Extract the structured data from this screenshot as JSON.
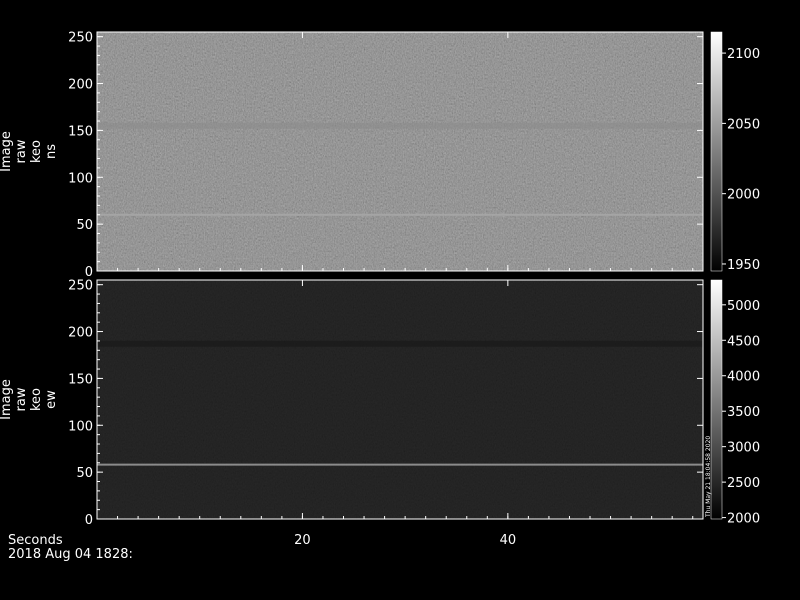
{
  "chart_data": [
    {
      "type": "heatmap",
      "title": "",
      "ylabel_lines": [
        "Image",
        "raw",
        "keo",
        "ns"
      ],
      "xlim": [
        0,
        59
      ],
      "ylim": [
        0,
        255
      ],
      "yticks": [
        0,
        50,
        100,
        150,
        200,
        250
      ],
      "colorbar": {
        "min": 1945,
        "max": 2115,
        "ticks": [
          1950,
          2000,
          2050,
          2100
        ]
      },
      "value_background": 2015,
      "features": [
        {
          "kind": "horizontal-line",
          "y": 60,
          "value": 2055
        },
        {
          "kind": "horizontal-band",
          "y": 155,
          "value": 2038
        }
      ]
    },
    {
      "type": "heatmap",
      "title": "",
      "ylabel_lines": [
        "Image",
        "raw",
        "keo",
        "ew"
      ],
      "xlim": [
        0,
        59
      ],
      "ylim": [
        0,
        255
      ],
      "yticks": [
        0,
        50,
        100,
        150,
        200,
        250
      ],
      "colorbar": {
        "min": 1980,
        "max": 5350,
        "ticks": [
          2000,
          2500,
          3000,
          3500,
          4000,
          4500,
          5000
        ]
      },
      "colorbar_note": "Thu May 21 18:04:58 2020",
      "value_background": 2180,
      "features": [
        {
          "kind": "horizontal-line",
          "y": 58,
          "value": 3900
        },
        {
          "kind": "horizontal-band",
          "y": 187,
          "value": 2300
        }
      ]
    }
  ],
  "xaxis": {
    "label": "Seconds",
    "ticks": [
      20,
      40
    ],
    "range": [
      0,
      59
    ]
  },
  "footer": {
    "date_label": "2018 Aug 04 1828:"
  }
}
